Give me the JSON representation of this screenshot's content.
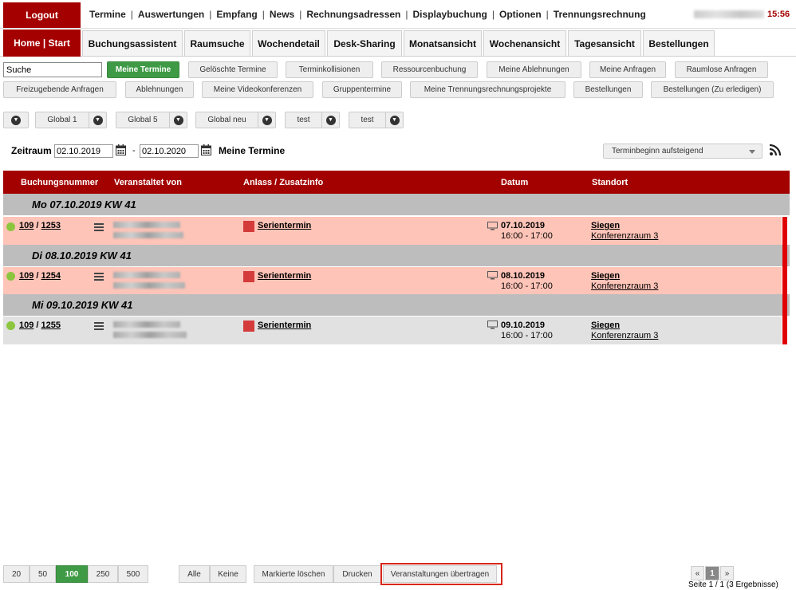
{
  "header": {
    "logout_label": "Logout",
    "nav": [
      "Termine",
      "Auswertungen",
      "Empfang",
      "News",
      "Rechnungsadressen",
      "Displaybuchung",
      "Optionen",
      "Trennungsrechnung"
    ],
    "separator": "|",
    "clock": "15:56"
  },
  "tabs": {
    "home_label": "Home | Start",
    "items": [
      "Buchungsassistent",
      "Raumsuche",
      "Wochendetail",
      "Desk-Sharing",
      "Monatsansicht",
      "Wochenansicht",
      "Tagesansicht",
      "Bestellungen"
    ]
  },
  "filters": {
    "search_value": "Suche",
    "row1": [
      "Meine Termine",
      "Gelöschte Termine",
      "Terminkollisionen",
      "Ressourcenbuchung",
      "Meine Ablehnungen",
      "Meine Anfragen",
      "Raumlose Anfragen"
    ],
    "row2": [
      "Freizugebende Anfragen",
      "Ablehnungen",
      "Meine Videokonferenzen",
      "Gruppentermine",
      "Meine Trennungsrechnungsprojekte",
      "Bestellungen",
      "Bestellungen (Zu erledigen)"
    ],
    "globals": [
      "Global 1",
      "Global 5",
      "Global neu",
      "test",
      "test"
    ]
  },
  "daterange": {
    "label": "Zeitraum",
    "from": "02.10.2019",
    "dash": "-",
    "to": "02.10.2020",
    "title": "Meine Termine",
    "sort_value": "Terminbeginn aufsteigend"
  },
  "table": {
    "columns": [
      "Buchungsnummer",
      "Veranstaltet von",
      "Anlass / Zusatzinfo",
      "Datum",
      "Standort"
    ],
    "groups": [
      {
        "day": "Mo 07.10.2019 KW 41",
        "num1": "109",
        "num2": "1253",
        "sep": "/",
        "anlass": "Serientermin",
        "date": "07.10.2019",
        "time": "16:00 - 17:00",
        "city": "Siegen",
        "room": "Konferenzraum 3"
      },
      {
        "day": "Di 08.10.2019 KW 41",
        "num1": "109",
        "num2": "1254",
        "sep": "/",
        "anlass": "Serientermin",
        "date": "08.10.2019",
        "time": "16:00 - 17:00",
        "city": "Siegen",
        "room": "Konferenzraum 3"
      },
      {
        "day": "Mi 09.10.2019 KW 41",
        "num1": "109",
        "num2": "1255",
        "sep": "/",
        "anlass": "Serientermin",
        "date": "09.10.2019",
        "time": "16:00 - 17:00",
        "city": "Siegen",
        "room": "Konferenzraum 3"
      }
    ]
  },
  "footer": {
    "page_sizes": [
      "20",
      "50",
      "100",
      "250",
      "500"
    ],
    "select_all": "Alle",
    "select_none": "Keine",
    "delete_marked": "Markierte löschen",
    "print": "Drucken",
    "transfer": "Veranstaltungen übertragen",
    "prev": "«",
    "page": "1",
    "next": "»",
    "page_info": "Seite 1 / 1 (3 Ergebnisse)"
  },
  "colors": {
    "brand_red": "#a50000",
    "active_green": "#3f9a46",
    "row_pink": "#ffc4b8",
    "status_green": "#8cc63f"
  }
}
